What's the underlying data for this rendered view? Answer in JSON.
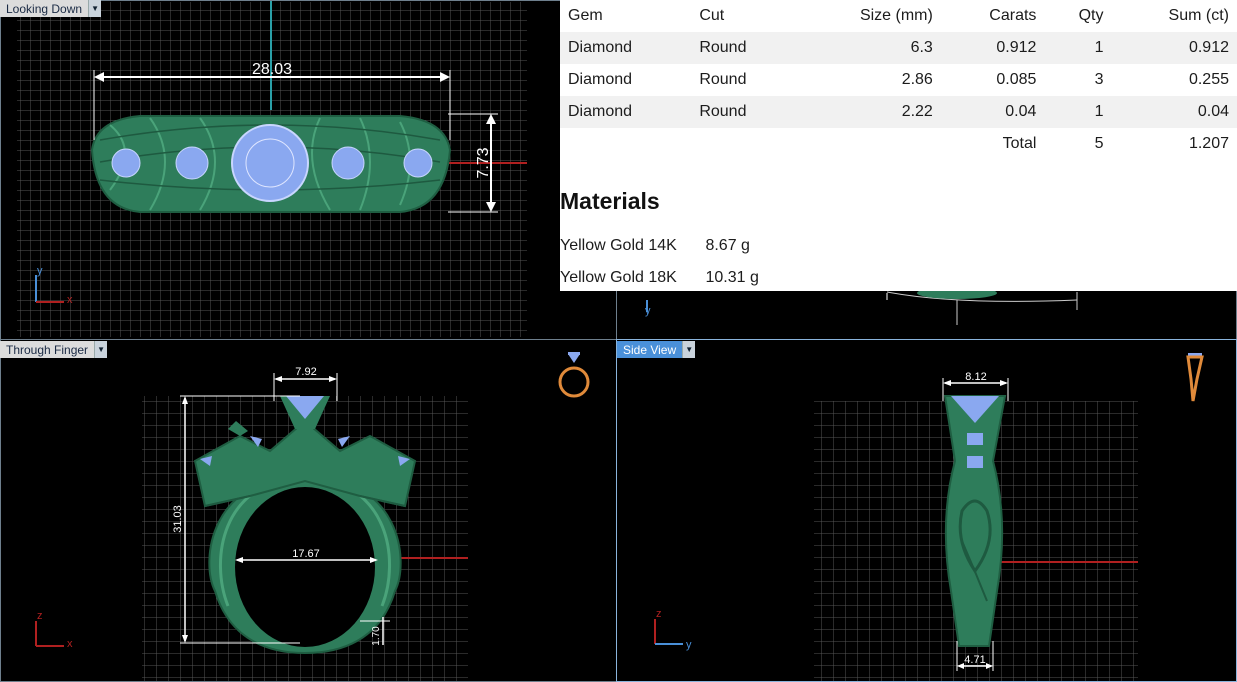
{
  "viewports": {
    "top_left": {
      "label": "Looking Down",
      "dim_width": "28.03",
      "dim_height": "7.73",
      "axis_v": "y",
      "axis_h": "x"
    },
    "bottom_left": {
      "label": "Through Finger",
      "dim_top": "7.92",
      "dim_height": "31.03",
      "dim_inner": "17.67",
      "dim_bottom": "1.70",
      "axis_v": "z",
      "axis_h": "x"
    },
    "bottom_right": {
      "label": "Side View",
      "dim_top": "8.12",
      "dim_bottom": "4.71",
      "axis_v": "z",
      "axis_h": "y"
    },
    "top_right": {
      "axis": "y"
    }
  },
  "gems": {
    "headers": [
      "Gem",
      "Cut",
      "Size (mm)",
      "Carats",
      "Qty",
      "Sum (ct)"
    ],
    "rows": [
      [
        "Diamond",
        "Round",
        "6.3",
        "0.912",
        "1",
        "0.912"
      ],
      [
        "Diamond",
        "Round",
        "2.86",
        "0.085",
        "3",
        "0.255"
      ],
      [
        "Diamond",
        "Round",
        "2.22",
        "0.04",
        "1",
        "0.04"
      ]
    ],
    "total": {
      "label": "Total",
      "qty": "5",
      "sum": "1.207"
    }
  },
  "materials": {
    "title": "Materials",
    "items": [
      {
        "name": "Yellow Gold 14K",
        "weight": "8.67 g"
      },
      {
        "name": "Yellow Gold 18K",
        "weight": "10.31 g"
      }
    ]
  },
  "colors": {
    "model_green": "#2e7d5b",
    "gem_blue": "#8aa8f0",
    "dimension_white": "#ffffff",
    "grid": "#5a5a5a",
    "axis_red": "#b02020",
    "axis_teal": "#2aa0a8",
    "active_tab": "#4a90d9"
  }
}
